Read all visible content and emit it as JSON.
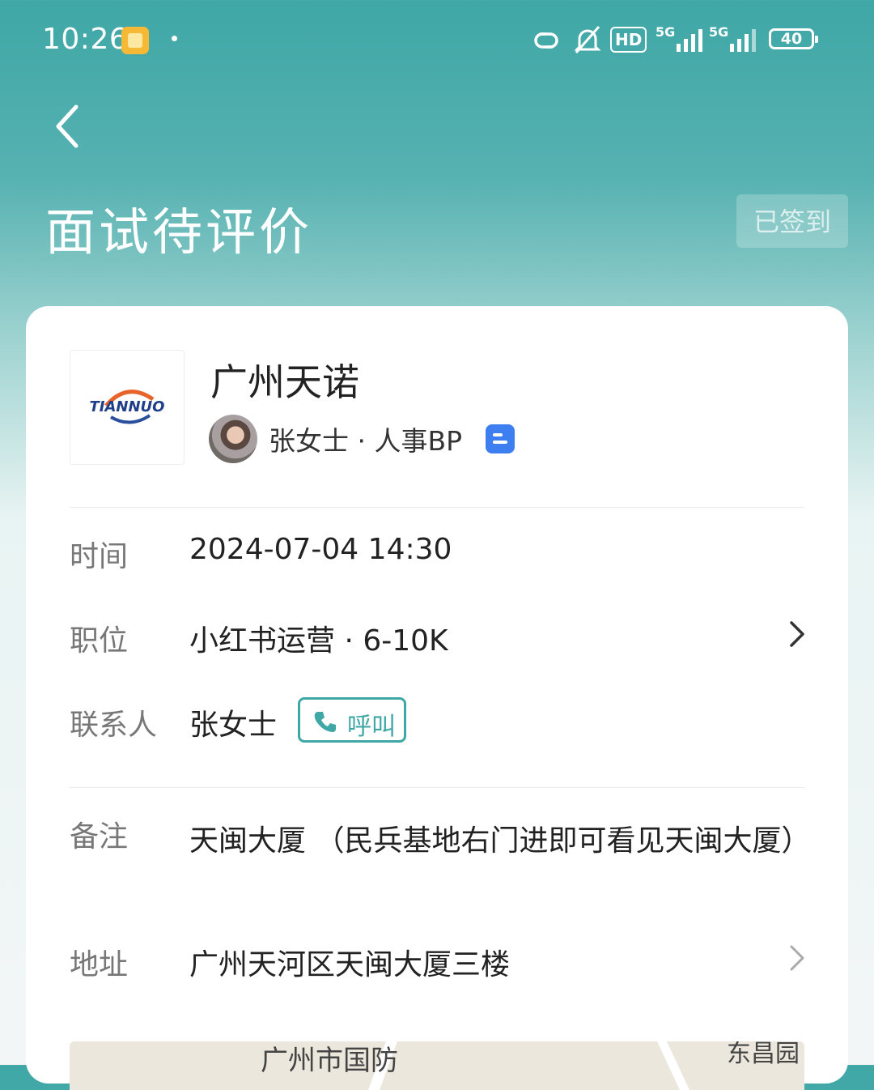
{
  "status_bar": {
    "time": "10:26",
    "hd_label": "HD",
    "net1": "5G",
    "net2": "5G",
    "battery": "40"
  },
  "header": {
    "title": "面试待评价",
    "signed_label": "已签到"
  },
  "company": {
    "name": "广州天诺",
    "logo_text": "TIANNUO"
  },
  "recruiter": {
    "line": "张女士 · 人事BP"
  },
  "details": {
    "time_label": "时间",
    "time_value": "2024-07-04 14:30",
    "position_label": "职位",
    "position_value": "小红书运营 · 6-10K",
    "contact_label": "联系人",
    "contact_value": "张女士",
    "call_label": "呼叫",
    "remark_label": "备注",
    "remark_value": "天闽大厦 （民兵基地右门进即可看见天闽大厦）",
    "address_label": "地址",
    "address_value": "广州天河区天闽大厦三楼"
  },
  "map": {
    "label1": "广州市国防",
    "label2": "东昌园"
  },
  "colors": {
    "accent": "#3fa7a6",
    "chat_badge": "#3d7ff0"
  }
}
